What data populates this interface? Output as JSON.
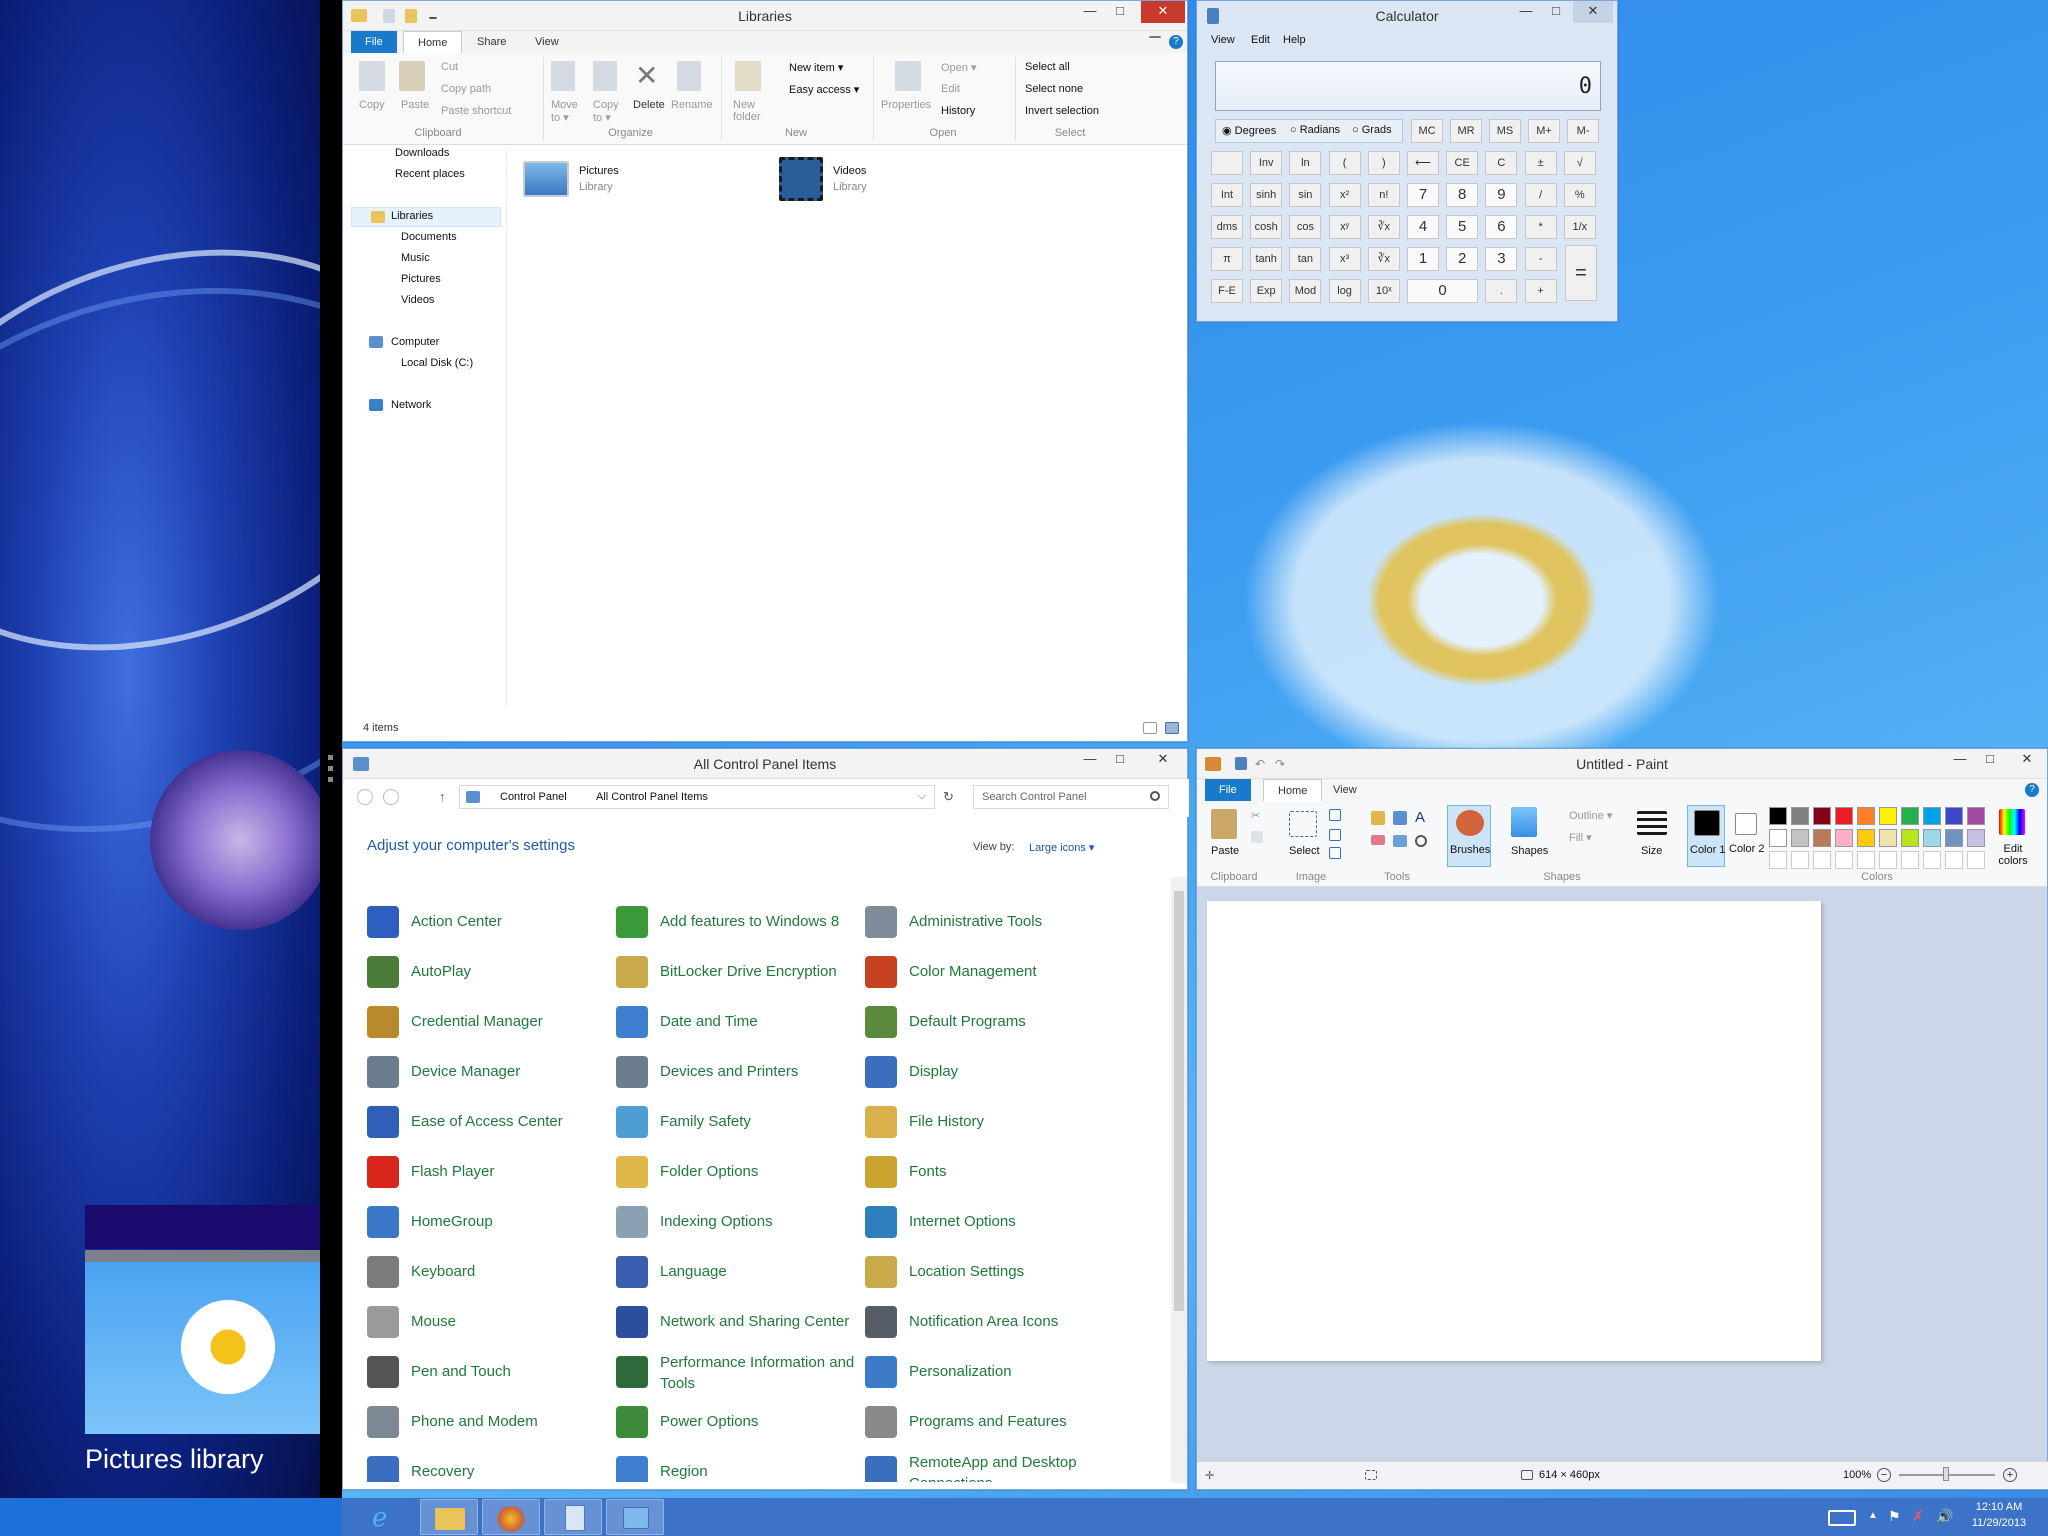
{
  "left_app": {
    "tile_label": "Pictures library"
  },
  "explorer": {
    "title": "Libraries",
    "tabs": [
      "File",
      "Home",
      "Share",
      "View"
    ],
    "ribbon": {
      "copy": "Copy",
      "paste": "Paste",
      "cut": "Cut",
      "copy_path": "Copy path",
      "paste_shortcut": "Paste shortcut",
      "move_to": "Move to ▾",
      "copy_to": "Copy to ▾",
      "delete": "Delete",
      "rename": "Rename",
      "new_folder": "New folder",
      "new_item": "New item ▾",
      "easy_access": "Easy access ▾",
      "properties": "Properties",
      "open": "Open ▾",
      "edit": "Edit",
      "history": "History",
      "select_all": "Select all",
      "select_none": "Select none",
      "invert_selection": "Invert selection",
      "groups": [
        "Clipboard",
        "Organize",
        "New",
        "Open",
        "Select"
      ]
    },
    "nav": [
      "Downloads",
      "Recent places",
      "Libraries",
      "Documents",
      "Music",
      "Pictures",
      "Videos",
      "Computer",
      "Local Disk (C:)",
      "Network"
    ],
    "items": [
      {
        "name": "Pictures",
        "sub": "Library"
      },
      {
        "name": "Videos",
        "sub": "Library"
      }
    ],
    "status": "4 items"
  },
  "calculator": {
    "title": "Calculator",
    "menu": [
      "View",
      "Edit",
      "Help"
    ],
    "display": "0",
    "modes": [
      "Degrees",
      "Radians",
      "Grads"
    ],
    "memory": [
      "MC",
      "MR",
      "MS",
      "M+",
      "M-"
    ],
    "rows": [
      [
        "",
        "Inv",
        "ln",
        "(",
        ")",
        "⟵",
        "CE",
        "C",
        "±",
        "√"
      ],
      [
        "Int",
        "sinh",
        "sin",
        "x²",
        "n!",
        "7",
        "8",
        "9",
        "/",
        "%"
      ],
      [
        "dms",
        "cosh",
        "cos",
        "xʸ",
        "∛x",
        "4",
        "5",
        "6",
        "*",
        "1/x"
      ],
      [
        "π",
        "tanh",
        "tan",
        "x³",
        "∛x",
        "1",
        "2",
        "3",
        "-",
        ""
      ],
      [
        "F-E",
        "Exp",
        "Mod",
        "log",
        "10ˣ",
        "0",
        "",
        ".",
        "+",
        ""
      ]
    ],
    "equals": "="
  },
  "control_panel": {
    "title": "All Control Panel Items",
    "breadcrumb": [
      "Control Panel",
      "All Control Panel Items"
    ],
    "search_placeholder": "Search Control Panel",
    "heading": "Adjust your computer's settings",
    "view_by_label": "View by:",
    "view_by_value": "Large icons ▾",
    "items": [
      [
        "Action Center",
        "Add features to Windows 8",
        "Administrative Tools"
      ],
      [
        "AutoPlay",
        "BitLocker Drive Encryption",
        "Color Management"
      ],
      [
        "Credential Manager",
        "Date and Time",
        "Default Programs"
      ],
      [
        "Device Manager",
        "Devices and Printers",
        "Display"
      ],
      [
        "Ease of Access Center",
        "Family Safety",
        "File History"
      ],
      [
        "Flash Player",
        "Folder Options",
        "Fonts"
      ],
      [
        "HomeGroup",
        "Indexing Options",
        "Internet Options"
      ],
      [
        "Keyboard",
        "Language",
        "Location Settings"
      ],
      [
        "Mouse",
        "Network and Sharing Center",
        "Notification Area Icons"
      ],
      [
        "Pen and Touch",
        "Performance Information and Tools",
        "Personalization"
      ],
      [
        "Phone and Modem",
        "Power Options",
        "Programs and Features"
      ],
      [
        "Recovery",
        "Region",
        "RemoteApp and Desktop Connections"
      ]
    ],
    "icon_colors": [
      [
        "#2d5fbf",
        "#3a9a3a",
        "#7f8c99"
      ],
      [
        "#4a7d3a",
        "#c9a94a",
        "#c7421f"
      ],
      [
        "#b98a2b",
        "#3f7fcf",
        "#5b8a3c"
      ],
      [
        "#6b7d8f",
        "#6b7d8f",
        "#3a6fc0"
      ],
      [
        "#2f5fb6",
        "#4e9ed4",
        "#d9b04a"
      ],
      [
        "#d8261c",
        "#e0b84a",
        "#c9a431"
      ],
      [
        "#3a79c9",
        "#8aa0b3",
        "#2e7fbf"
      ],
      [
        "#7b7b7b",
        "#3a5fb0",
        "#c9a94a"
      ],
      [
        "#9a9a9a",
        "#2a4f9f",
        "#555d66"
      ],
      [
        "#555555",
        "#2f6b3a",
        "#3b7bc8"
      ],
      [
        "#7c8894",
        "#3d8a3a",
        "#8a8a8a"
      ],
      [
        "#3a6fbf",
        "#3f7fcf",
        "#3a6fbf"
      ]
    ]
  },
  "paint": {
    "title": "Untitled - Paint",
    "tabs": [
      "File",
      "Home",
      "View"
    ],
    "ribbon": {
      "paste": "Paste",
      "select": "Select",
      "brushes": "Brushes",
      "shapes": "Shapes",
      "outline": "Outline ▾",
      "fill": "Fill ▾",
      "size": "Size",
      "color1": "Color 1",
      "color2": "Color 2",
      "edit_colors": "Edit colors",
      "groups": [
        "Clipboard",
        "Image",
        "Tools",
        "Shapes",
        "Colors"
      ]
    },
    "palette": [
      "#000000",
      "#7f7f7f",
      "#880015",
      "#ed1c24",
      "#ff7f27",
      "#fff200",
      "#22b14c",
      "#00a2e8",
      "#3f48cc",
      "#a349a4",
      "#ffffff",
      "#c3c3c3",
      "#b97a57",
      "#ffaec9",
      "#ffc90e",
      "#efe4b0",
      "#b5e61d",
      "#99d9ea",
      "#7092be",
      "#c8bfe7"
    ],
    "status_size": "614 × 460px",
    "zoom": "100%"
  },
  "taskbar": {
    "clock_time": "12:10 AM",
    "clock_date": "11/29/2013",
    "apps": [
      "internet-explorer",
      "file-explorer",
      "paint",
      "calculator",
      "control-panel"
    ]
  }
}
